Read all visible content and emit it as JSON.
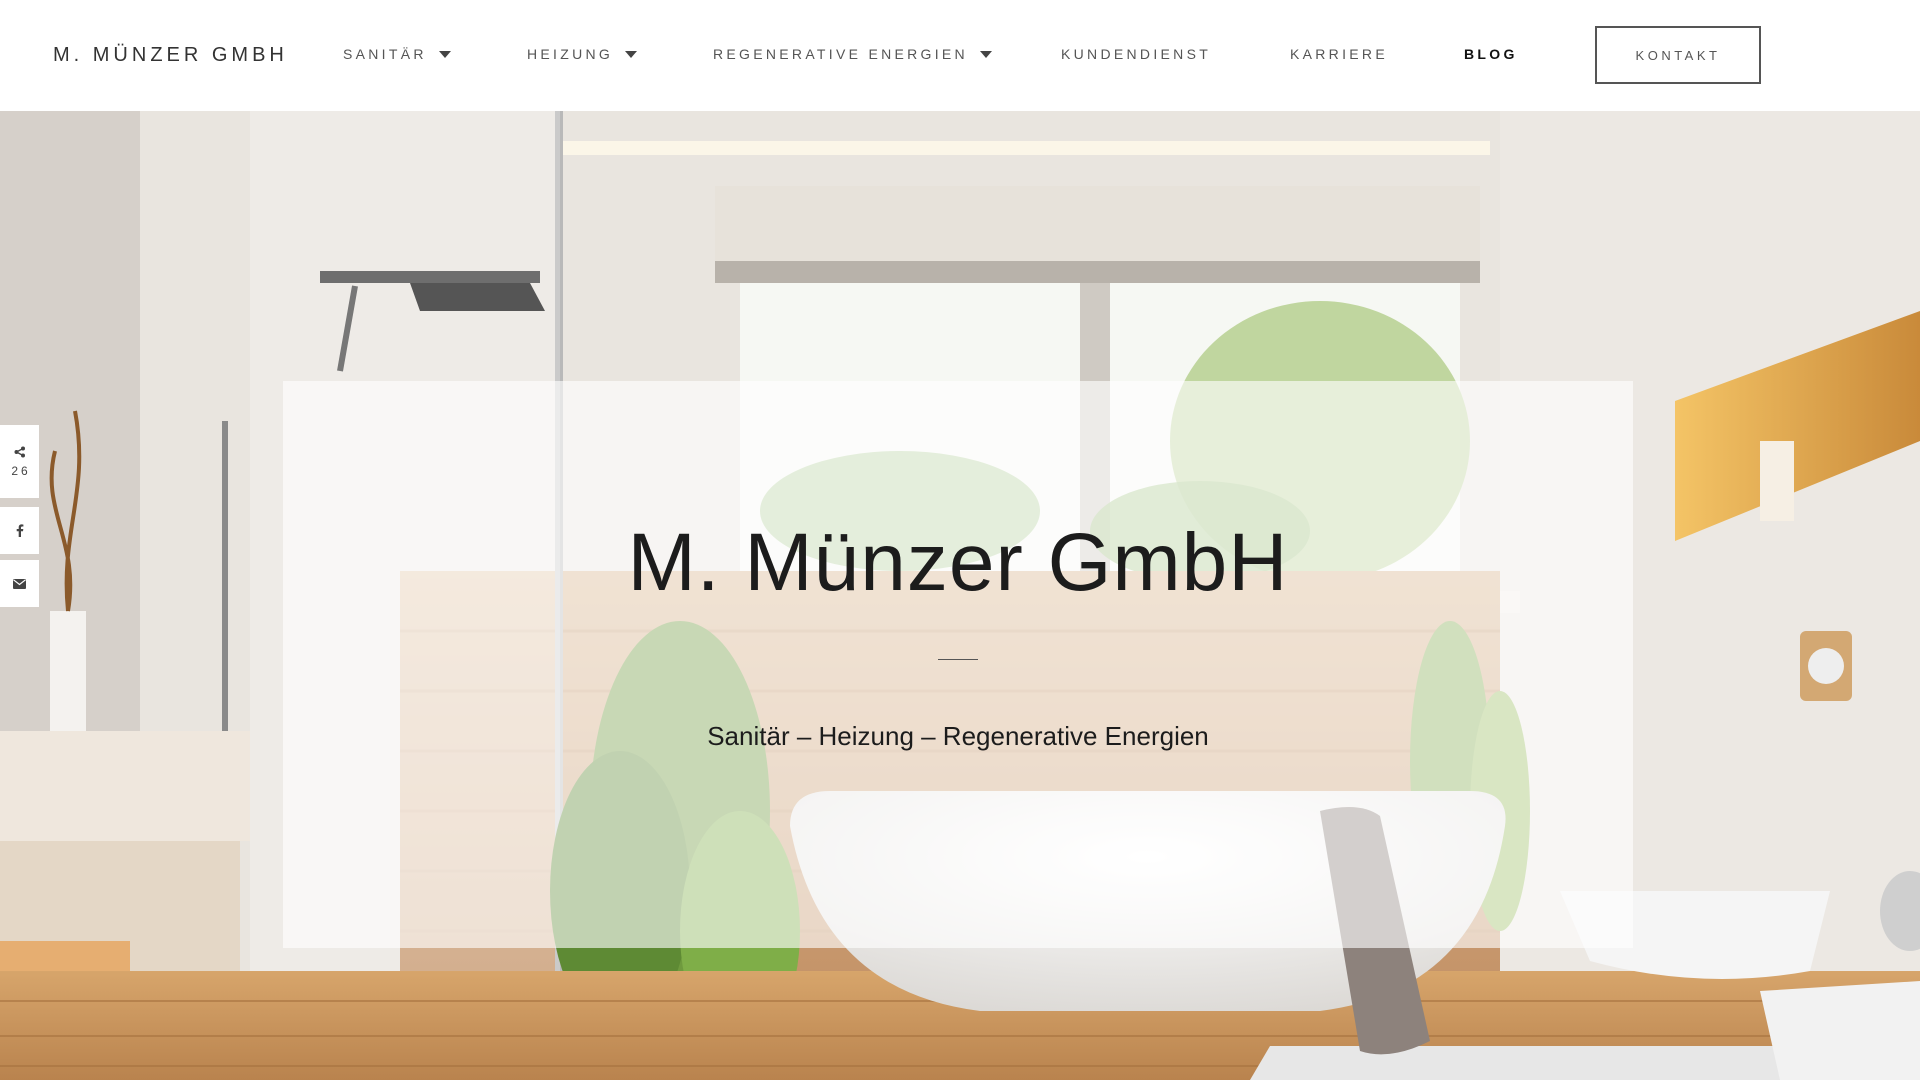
{
  "header": {
    "brand": "M. MÜNZER GMBH",
    "nav": [
      {
        "label": "SANITÄR",
        "dropdown": true
      },
      {
        "label": "HEIZUNG",
        "dropdown": true
      },
      {
        "label": "REGENERATIVE ENERGIEN",
        "dropdown": true
      },
      {
        "label": "KUNDENDIENST",
        "dropdown": false
      },
      {
        "label": "KARRIERE",
        "dropdown": false
      },
      {
        "label": "BLOG",
        "dropdown": false,
        "active": true
      }
    ],
    "contact_label": "KONTAKT"
  },
  "hero": {
    "title": "M. Münzer GmbH",
    "subtitle": "Sanitär – Heizung – Regenerative Energien",
    "background": "bathroom-photo"
  },
  "share_bar": {
    "count": "26",
    "icons": [
      "share-icon",
      "facebook-icon",
      "email-icon"
    ]
  },
  "colors": {
    "text": "#222222",
    "nav": "#555555",
    "card": "rgba(255,255,255,0.62)"
  }
}
